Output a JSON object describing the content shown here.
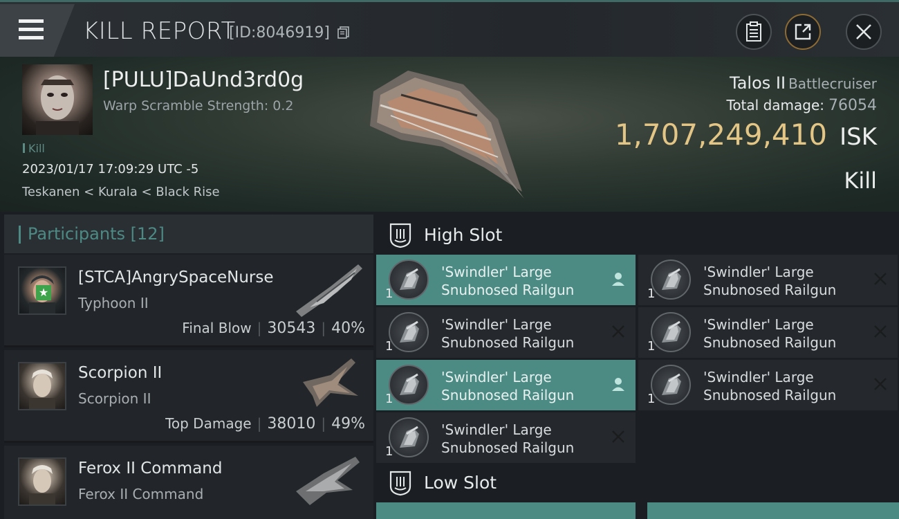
{
  "titlebar": {
    "title": "KILL REPORT",
    "id_text": "[ID:8046919]",
    "icons": [
      "menu-icon",
      "copy-icon",
      "report-icon",
      "share-icon",
      "close-icon"
    ]
  },
  "victim": {
    "name": "[PULU]DaUnd3rd0g",
    "warp_scramble": "Warp Scramble Strength: 0.2",
    "kill_tag": "Kill",
    "datetime": "2023/01/17 17:09:29 UTC -5",
    "location": "Teskanen < Kurala < Black Rise",
    "ship": "Talos II",
    "ship_class": "Battlecruiser",
    "total_damage_label": "Total damage:",
    "total_damage": "76054",
    "isk_value": "1,707,249,410",
    "isk_unit": "ISK",
    "result": "Kill"
  },
  "participants": {
    "header_label": "Participants",
    "count": "[12]",
    "items": [
      {
        "name": "[STCA]AngrySpaceNurse",
        "ship": "Typhoon II",
        "tag": "Final Blow",
        "damage": "30543",
        "percent": "40%"
      },
      {
        "name": "Scorpion II",
        "ship": "Scorpion II",
        "tag": "Top Damage",
        "damage": "38010",
        "percent": "49%"
      },
      {
        "name": "Ferox II Command",
        "ship": "Ferox II Command"
      }
    ]
  },
  "fitting": {
    "high_slot": {
      "title": "High Slot",
      "modules": [
        {
          "qty": "1",
          "name1": "'Swindler' Large",
          "name2": "Snubnosed Railgun",
          "state": "dropped"
        },
        {
          "qty": "1",
          "name1": "'Swindler' Large",
          "name2": "Snubnosed Railgun",
          "state": "destroyed"
        },
        {
          "qty": "1",
          "name1": "'Swindler' Large",
          "name2": "Snubnosed Railgun",
          "state": "destroyed"
        },
        {
          "qty": "1",
          "name1": "'Swindler' Large",
          "name2": "Snubnosed Railgun",
          "state": "destroyed"
        },
        {
          "qty": "1",
          "name1": "'Swindler' Large",
          "name2": "Snubnosed Railgun",
          "state": "dropped"
        },
        {
          "qty": "1",
          "name1": "'Swindler' Large",
          "name2": "Snubnosed Railgun",
          "state": "destroyed"
        },
        {
          "qty": "1",
          "name1": "'Swindler' Large",
          "name2": "Snubnosed Railgun",
          "state": "destroyed"
        }
      ]
    },
    "low_slot": {
      "title": "Low Slot"
    }
  },
  "colors": {
    "accent_teal": "#4b8b84",
    "isk_gold": "#e3c585",
    "final_blow_badge": "#3ea34a"
  }
}
